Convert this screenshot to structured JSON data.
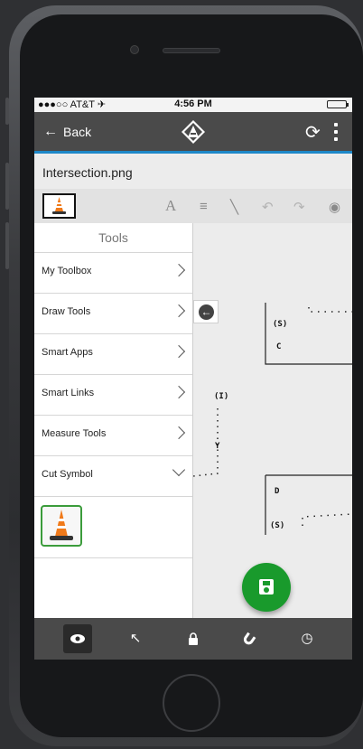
{
  "status": {
    "carrier": "●●●○○ AT&T ✈",
    "time": "4:56 PM"
  },
  "appbar": {
    "back_label": "Back",
    "back_icon": "←",
    "refresh_icon": "⟳"
  },
  "file": {
    "name": "Intersection.png"
  },
  "toolbar": {
    "icons": [
      {
        "name": "text-icon",
        "glyph": "A"
      },
      {
        "name": "lines-icon",
        "glyph": "≡"
      },
      {
        "name": "pen-icon",
        "glyph": "╲"
      },
      {
        "name": "undo-icon",
        "glyph": "↶"
      },
      {
        "name": "redo-icon",
        "glyph": "↷"
      },
      {
        "name": "eye-icon",
        "glyph": "◉"
      }
    ]
  },
  "tools": {
    "title": "Tools",
    "items": [
      {
        "label": "My Toolbox",
        "expanded": false
      },
      {
        "label": "Draw Tools",
        "expanded": false
      },
      {
        "label": "Smart Apps",
        "expanded": false
      },
      {
        "label": "Smart Links",
        "expanded": false
      },
      {
        "label": "Measure Tools",
        "expanded": false
      },
      {
        "label": "Cut Symbol",
        "expanded": true
      }
    ]
  },
  "diagram": {
    "labels": {
      "s_top": "(S)",
      "c": "C",
      "i": "(I)",
      "y": "Y",
      "d": "D",
      "s_bottom": "(S)"
    }
  },
  "bottombar": {
    "items": [
      {
        "name": "view-icon",
        "glyph": "●",
        "active": true
      },
      {
        "name": "pointer-icon",
        "glyph": "↖",
        "active": false
      },
      {
        "name": "lock-icon",
        "glyph": "🔒",
        "active": false
      },
      {
        "name": "magnet-icon",
        "glyph": "∪",
        "active": false
      },
      {
        "name": "clock-icon",
        "glyph": "◷",
        "active": false
      }
    ]
  },
  "colors": {
    "accent": "#1e88c8",
    "fab": "#199a2c",
    "bar": "#4a4a4a"
  }
}
